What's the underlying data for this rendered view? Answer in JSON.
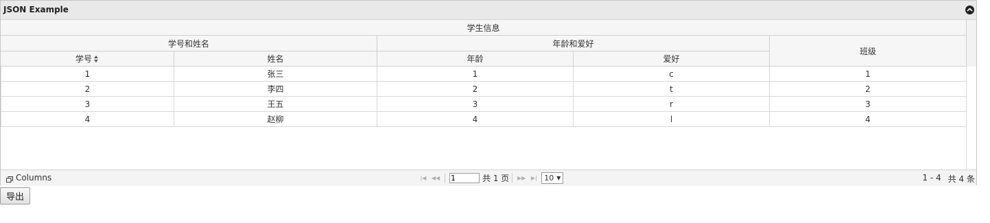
{
  "grid": {
    "title": "JSON Example",
    "group_top": "学生信息",
    "group_id_name": "学号和姓名",
    "group_age_hobby": "年龄和爱好",
    "columns": [
      "学号",
      "姓名",
      "年龄",
      "爱好",
      "班级"
    ],
    "rows": [
      [
        "1",
        "张三",
        "1",
        "c",
        "1"
      ],
      [
        "2",
        "李四",
        "2",
        "t",
        "2"
      ],
      [
        "3",
        "王五",
        "3",
        "r",
        "3"
      ],
      [
        "4",
        "赵柳",
        "4",
        "l",
        "4"
      ]
    ]
  },
  "pager": {
    "columns_label": "Columns",
    "current_page": "1",
    "total_pages_text": "共 1 页",
    "page_size": "10",
    "range_text": "1 - 4",
    "total_records_text": "共 4 条"
  },
  "export_label": "导出"
}
